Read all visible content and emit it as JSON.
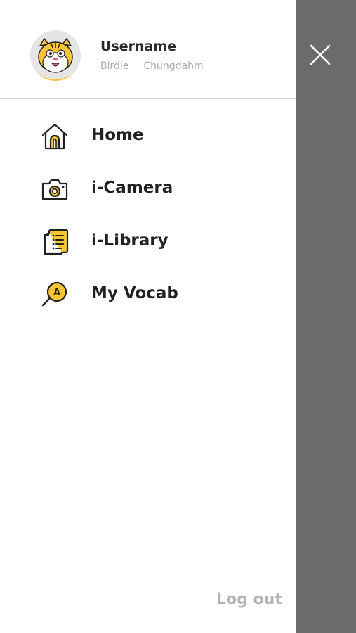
{
  "profile": {
    "username": "Username",
    "level": "Birdie",
    "school": "Chungdahm",
    "avatar_icon": "cartoon-mascot-avatar"
  },
  "menu": {
    "items": [
      {
        "label": "Home",
        "icon": "house-icon"
      },
      {
        "label": "i-Camera",
        "icon": "camera-icon"
      },
      {
        "label": "i-Library",
        "icon": "book-list-icon"
      },
      {
        "label": "My Vocab",
        "icon": "vocab-search-icon"
      }
    ]
  },
  "footer": {
    "logout_label": "Log out"
  },
  "colors": {
    "accent": "#f7c531",
    "overlay": "#6b6b6b",
    "text": "#222222",
    "muted": "#a9a9a9"
  }
}
